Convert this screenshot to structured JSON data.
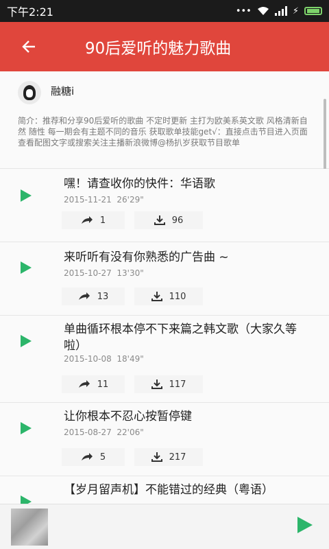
{
  "status_bar": {
    "time": "下午2:21"
  },
  "app_bar": {
    "title": "90后爱听的魅力歌曲"
  },
  "profile": {
    "name": "融糖i",
    "intro": "简介：推荐和分享90后爱听的歌曲 不定时更新 主打为欧美系英文歌 风格清新自然 随性   每一期会有主题不同的音乐  获取歌单技能get√：直接点击节目进入页面查看配图文字或搜索关注主播新浪微博@杨扒岁获取节目歌单"
  },
  "songs": [
    {
      "title": "嘿！请查收你的快件：华语歌",
      "date": "2015-11-21",
      "duration": "26'29\"",
      "shares": "1",
      "downloads": "96"
    },
    {
      "title": "来听听有没有你熟悉的广告曲 ~",
      "date": "2015-10-27",
      "duration": "13'30\"",
      "shares": "13",
      "downloads": "110"
    },
    {
      "title": "单曲循环根本停不下来篇之韩文歌（大家久等啦）",
      "date": "2015-10-08",
      "duration": "18'49\"",
      "shares": "11",
      "downloads": "117"
    },
    {
      "title": "让你根本不忍心按暂停键",
      "date": "2015-08-27",
      "duration": "22'06\"",
      "shares": "5",
      "downloads": "217"
    },
    {
      "title": "【岁月留声机】不能错过的经典（粤语）"
    }
  ],
  "colors": {
    "accent": "#e0463c",
    "play": "#2cb56a"
  }
}
